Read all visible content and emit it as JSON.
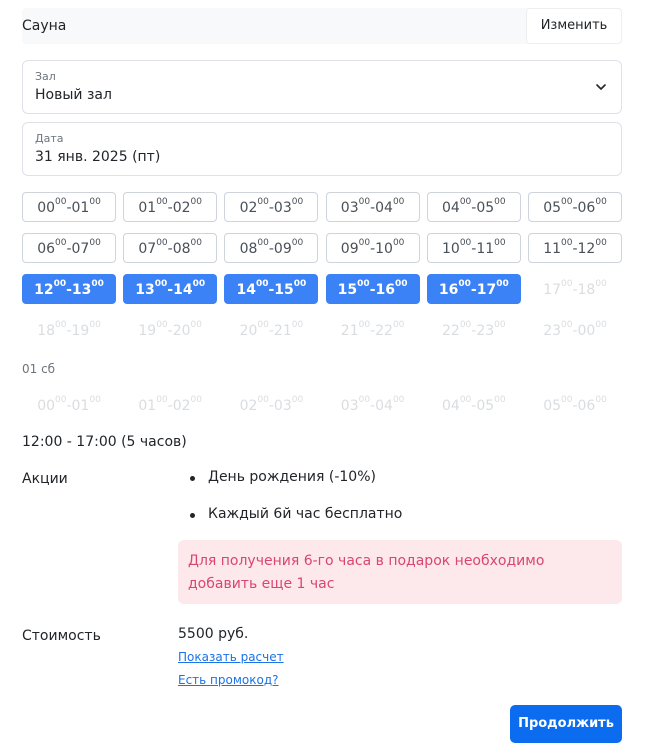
{
  "service": {
    "name": "Сауна",
    "change_label": "Изменить"
  },
  "hall_field": {
    "label": "Зал",
    "value": "Новый зал"
  },
  "date_field": {
    "label": "Дата",
    "value": "31 янв. 2025 (пт)"
  },
  "slots_day1": [
    {
      "from_h": "00",
      "to_h": "01",
      "state": "available"
    },
    {
      "from_h": "01",
      "to_h": "02",
      "state": "available"
    },
    {
      "from_h": "02",
      "to_h": "03",
      "state": "available"
    },
    {
      "from_h": "03",
      "to_h": "04",
      "state": "available"
    },
    {
      "from_h": "04",
      "to_h": "05",
      "state": "available"
    },
    {
      "from_h": "05",
      "to_h": "06",
      "state": "available"
    },
    {
      "from_h": "06",
      "to_h": "07",
      "state": "available"
    },
    {
      "from_h": "07",
      "to_h": "08",
      "state": "available"
    },
    {
      "from_h": "08",
      "to_h": "09",
      "state": "available"
    },
    {
      "from_h": "09",
      "to_h": "10",
      "state": "available"
    },
    {
      "from_h": "10",
      "to_h": "11",
      "state": "available"
    },
    {
      "from_h": "11",
      "to_h": "12",
      "state": "available"
    },
    {
      "from_h": "12",
      "to_h": "13",
      "state": "selected"
    },
    {
      "from_h": "13",
      "to_h": "14",
      "state": "selected"
    },
    {
      "from_h": "14",
      "to_h": "15",
      "state": "selected"
    },
    {
      "from_h": "15",
      "to_h": "16",
      "state": "selected"
    },
    {
      "from_h": "16",
      "to_h": "17",
      "state": "selected"
    },
    {
      "from_h": "17",
      "to_h": "18",
      "state": "disabled"
    },
    {
      "from_h": "18",
      "to_h": "19",
      "state": "disabled"
    },
    {
      "from_h": "19",
      "to_h": "20",
      "state": "disabled"
    },
    {
      "from_h": "20",
      "to_h": "21",
      "state": "disabled"
    },
    {
      "from_h": "21",
      "to_h": "22",
      "state": "disabled"
    },
    {
      "from_h": "22",
      "to_h": "23",
      "state": "disabled"
    },
    {
      "from_h": "23",
      "to_h": "00",
      "state": "disabled"
    }
  ],
  "minutes": "00",
  "next_day_label": "01 сб",
  "slots_day2": [
    {
      "from_h": "00",
      "to_h": "01",
      "state": "disabled"
    },
    {
      "from_h": "01",
      "to_h": "02",
      "state": "disabled"
    },
    {
      "from_h": "02",
      "to_h": "03",
      "state": "disabled"
    },
    {
      "from_h": "03",
      "to_h": "04",
      "state": "disabled"
    },
    {
      "from_h": "04",
      "to_h": "05",
      "state": "disabled"
    },
    {
      "from_h": "05",
      "to_h": "06",
      "state": "disabled"
    }
  ],
  "summary": "12:00 - 17:00 (5 часов)",
  "promotions": {
    "title": "Акции",
    "items": [
      "День рождения (-10%)",
      "Каждый 6й час бесплатно"
    ],
    "alert": "Для получения 6-го часа в подарок необходимо добавить еще 1 час"
  },
  "cost": {
    "label": "Стоимость",
    "value": "5500 руб.",
    "show_calc_link": "Показать расчет",
    "promo_code_link": "Есть промокод?"
  },
  "continue_label": "Продолжить",
  "colors": {
    "selected": "#3b82f6",
    "primary": "#0b6cf0",
    "alert_bg": "#fde8ec",
    "alert_text": "#d9466e"
  }
}
